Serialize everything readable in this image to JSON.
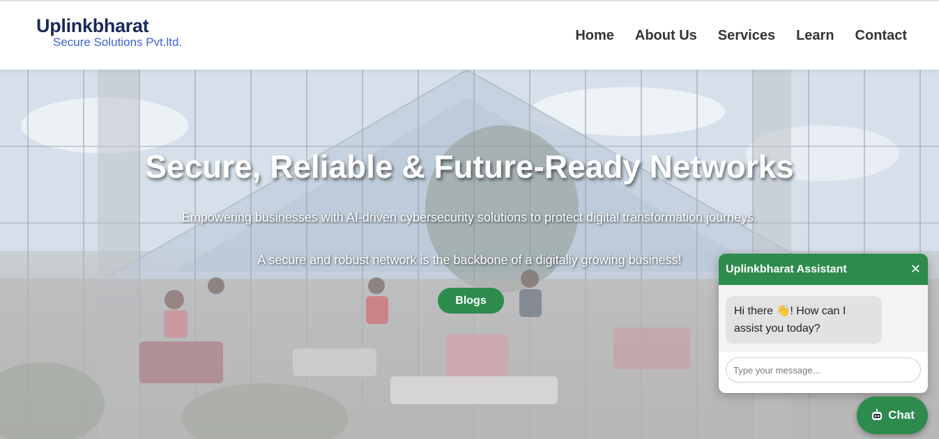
{
  "brand": {
    "name": "Uplinkbharat",
    "tagline": "Secure Solutions Pvt.ltd."
  },
  "nav": {
    "items": [
      {
        "label": "Home"
      },
      {
        "label": "About Us"
      },
      {
        "label": "Services"
      },
      {
        "label": "Learn"
      },
      {
        "label": "Contact"
      }
    ]
  },
  "hero": {
    "title": "Secure, Reliable & Future-Ready Networks",
    "line1": "Empowering businesses with AI-driven cybersecurity solutions to protect digital transformation journeys.",
    "line2": "A secure and robust network is the backbone of a digitally growing business!",
    "button_label": "Blogs",
    "background_icon": "office-building-photo"
  },
  "chat": {
    "title": "Uplinkbharat Assistant",
    "close_icon": "close-icon",
    "greeting": "Hi there 👋! How can I assist you today?",
    "input_placeholder": "Type your message...",
    "fab_label": "Chat",
    "fab_icon": "robot-icon"
  },
  "colors": {
    "brand_dark": "#1b2a5c",
    "brand_blue": "#3a62d6",
    "accent_green": "#2e8b4e",
    "nav_text": "#333333"
  }
}
